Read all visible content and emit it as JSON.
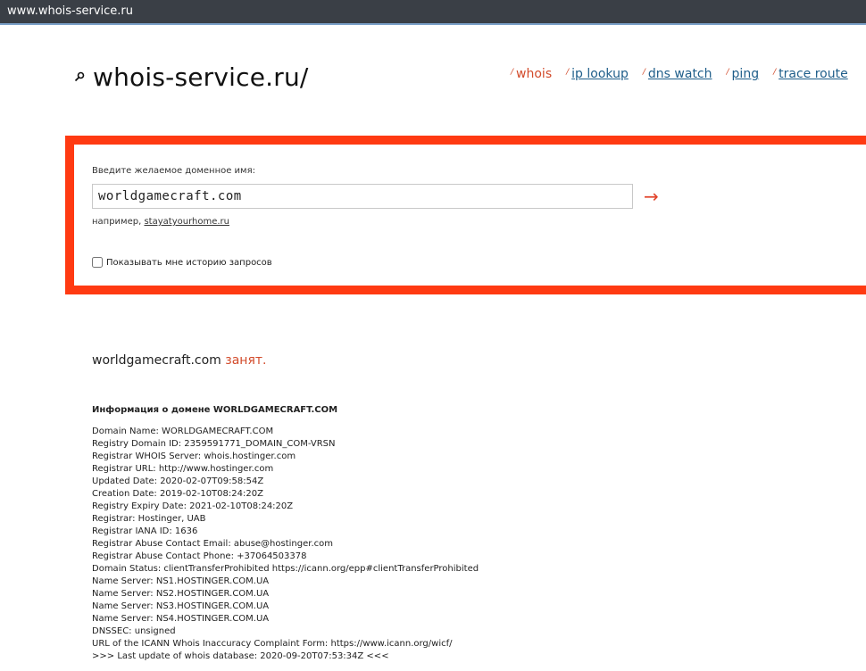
{
  "browser": {
    "url": "www.whois-service.ru"
  },
  "header": {
    "logo_text": "whois-service.ru/",
    "nav": [
      {
        "label": "whois",
        "active": true
      },
      {
        "label": "ip lookup",
        "active": false
      },
      {
        "label": "dns watch",
        "active": false
      },
      {
        "label": "ping",
        "active": false
      },
      {
        "label": "trace route",
        "active": false
      }
    ]
  },
  "search": {
    "label": "Введите желаемое доменное имя:",
    "value": "worldgamecraft.com",
    "submit_icon": "→",
    "example_prefix": "например,",
    "example_link": "stayatyourhome.ru",
    "history_label": "Показывать мне историю запросов",
    "history_checked": false
  },
  "result": {
    "domain": "worldgamecraft.com",
    "status": "занят.",
    "info_heading": "Информация о домене WORLDGAMECRAFT.COM",
    "lines": [
      "Domain Name: WORLDGAMECRAFT.COM",
      "Registry Domain ID: 2359591771_DOMAIN_COM-VRSN",
      "Registrar WHOIS Server: whois.hostinger.com",
      "Registrar URL: http://www.hostinger.com",
      "Updated Date: 2020-02-07T09:58:54Z",
      "Creation Date: 2019-02-10T08:24:20Z",
      "Registry Expiry Date: 2021-02-10T08:24:20Z",
      "Registrar: Hostinger, UAB",
      "Registrar IANA ID: 1636",
      "Registrar Abuse Contact Email: abuse@hostinger.com",
      "Registrar Abuse Contact Phone: +37064503378",
      "Domain Status: clientTransferProhibited https://icann.org/epp#clientTransferProhibited",
      "Name Server: NS1.HOSTINGER.COM.UA",
      "Name Server: NS2.HOSTINGER.COM.UA",
      "Name Server: NS3.HOSTINGER.COM.UA",
      "Name Server: NS4.HOSTINGER.COM.UA",
      "DNSSEC: unsigned",
      "URL of the ICANN Whois Inaccuracy Complaint Form: https://www.icann.org/wicf/",
      ">>> Last update of whois database: 2020-09-20T07:53:34Z <<<"
    ]
  },
  "colors": {
    "accent": "#ff3a12",
    "link": "#1f5e8a",
    "active": "#d24a2a"
  }
}
